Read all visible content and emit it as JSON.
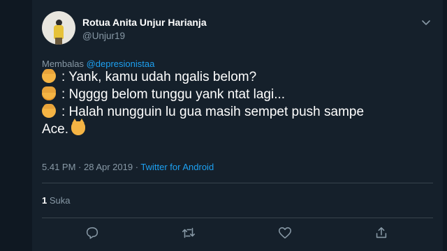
{
  "tweet": {
    "author_name": "Rotua Anita Unjur Harianja",
    "author_handle": "@Unjur19",
    "reply_prefix": "Membalas",
    "reply_mention": "@depresionistaa",
    "lines": [
      {
        "emoji": "man-emoji",
        "text": ": Yank, kamu udah ngalis belom?"
      },
      {
        "emoji": "woman-emoji",
        "text": ": Ngggg belom tunggu yank ntat lagi..."
      },
      {
        "emoji": "man-emoji",
        "text": ": Halah nungguin lu gua masih sempet push sampe"
      }
    ],
    "last_line_text": "Ace.",
    "last_line_emoji": "pouting-cat-emoji",
    "timestamp": "5.41 PM · 28 Apr 2019 · ",
    "source": "Twitter for Android",
    "like_count": "1",
    "like_label": " Suka"
  },
  "icons": {
    "caret": "chevron-down-icon",
    "reply": "reply-icon",
    "retweet": "retweet-icon",
    "like": "heart-icon",
    "share": "share-icon"
  },
  "colors": {
    "background": "#15202b",
    "text_primary": "#ffffff",
    "text_secondary": "#8899a6",
    "accent": "#1da1f2",
    "divider": "#38444d"
  }
}
